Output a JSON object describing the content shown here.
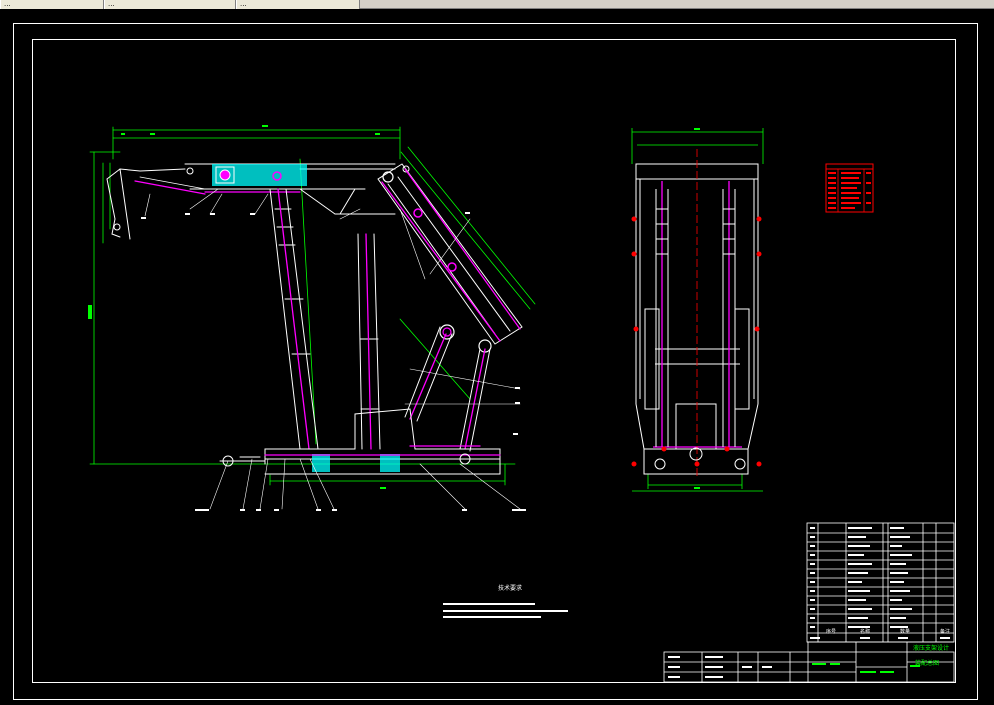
{
  "tabs": [
    {
      "label": "..."
    },
    {
      "label": "..."
    },
    {
      "label": "..."
    }
  ],
  "drawing": {
    "tech_requirements_heading": "技术要求",
    "title_block_name": "液压支架设计",
    "title_block_drawing": "装配总图",
    "parts_list_header": {
      "no": "序号",
      "name": "名称",
      "qty": "数量",
      "remark": "备注"
    }
  },
  "colors": {
    "background": "#000000",
    "line_white": "#ffffff",
    "green": "#00ff00",
    "magenta": "#ff00ff",
    "cyan": "#00ffff",
    "red": "#ff0000"
  },
  "icons": [
    "close-icon"
  ]
}
